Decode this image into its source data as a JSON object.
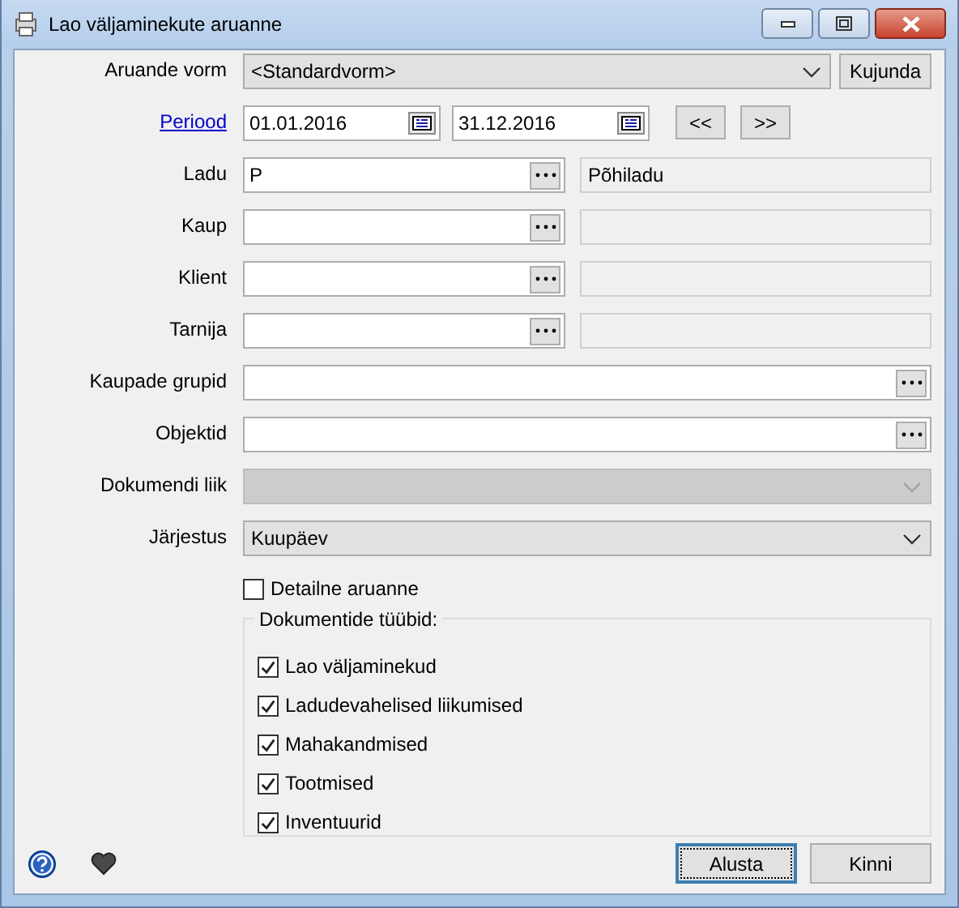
{
  "window": {
    "title": "Lao väljaminekute aruanne"
  },
  "rows": [
    {
      "label": "Aruande vorm",
      "kind": "dropdown",
      "value": "<Standardvorm>",
      "button": "Kujunda",
      "disabled": false
    },
    {
      "label": "Periood",
      "kind": "period",
      "from": "01.01.2016",
      "to": "31.12.2016",
      "buttons": [
        "<<",
        ">>"
      ]
    },
    {
      "label": "Ladu",
      "kind": "lookup",
      "value": "P",
      "name": "Põhiladu"
    },
    {
      "label": "Kaup",
      "kind": "lookup"
    },
    {
      "label": "Klient",
      "kind": "lookup"
    },
    {
      "label": "Tarnija",
      "kind": "lookup"
    },
    {
      "label": "Kaupade grupid",
      "kind": "picker"
    },
    {
      "label": "Objektid",
      "kind": "picker"
    },
    {
      "label": "Dokumendi liik",
      "kind": "dropdown",
      "disabled": true
    },
    {
      "label": "Järjestus",
      "kind": "dropdown",
      "value": "Kuupäev",
      "disabled": false
    }
  ],
  "detail": {
    "label": "Detailne aruanne",
    "checked": false
  },
  "doc_types": {
    "title": "Dokumentide tüübid:",
    "items": [
      {
        "label": "Lao väljaminekud",
        "checked": true
      },
      {
        "label": "Ladudevahelised liikumised",
        "checked": true
      },
      {
        "label": "Mahakandmised",
        "checked": true
      },
      {
        "label": "Tootmised",
        "checked": true
      },
      {
        "label": "Inventuurid",
        "checked": true
      }
    ]
  },
  "buttons": [
    {
      "label": "Alusta",
      "default": true
    },
    {
      "label": "Kinni",
      "default": false
    }
  ]
}
